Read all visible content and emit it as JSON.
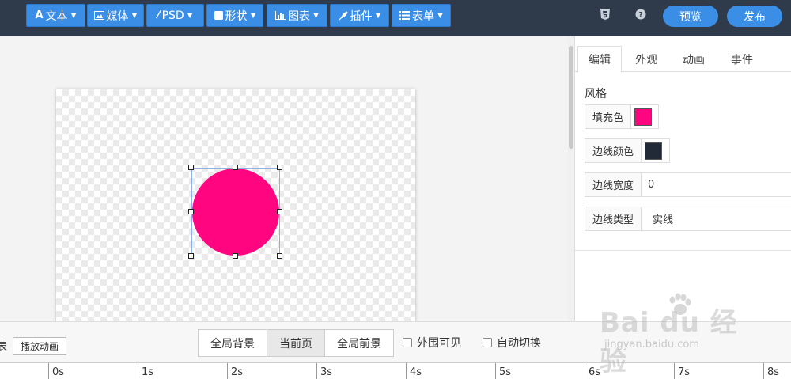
{
  "toolbar": {
    "items": [
      {
        "label": "文本",
        "icon": "text-icon"
      },
      {
        "label": "媒体",
        "icon": "image-icon"
      },
      {
        "label": "PSD",
        "icon": "magic-wand-icon"
      },
      {
        "label": "形状",
        "icon": "square-icon"
      },
      {
        "label": "图表",
        "icon": "bar-chart-icon"
      },
      {
        "label": "插件",
        "icon": "plug-icon"
      },
      {
        "label": "表单",
        "icon": "list-icon"
      }
    ],
    "preview_label": "预览",
    "publish_label": "发布",
    "accent_color": "#3b8ee6",
    "bar_color": "#2f3a4a"
  },
  "canvas": {
    "shape": "circle",
    "fill_color": "#ff0580",
    "border_color": "#222a38"
  },
  "panel": {
    "tabs": [
      "编辑",
      "外观",
      "动画",
      "事件"
    ],
    "active_tab": "编辑",
    "section_title": "风格",
    "fill_label": "填充色",
    "border_color_label": "边线颜色",
    "border_width_label": "边线宽度",
    "border_width_value": "0",
    "border_type_label": "边线类型",
    "border_type_value": "实线"
  },
  "bottom": {
    "truncated_text": "表",
    "play_label": "播放动画",
    "segments": [
      "全局背景",
      "当前页",
      "全局前景"
    ],
    "active_segment": "当前页",
    "checkbox_outside_visible": "外围可见",
    "checkbox_auto_switch": "自动切换"
  },
  "timeline": {
    "ticks": [
      "0s",
      "1s",
      "2s",
      "3s",
      "4s",
      "5s",
      "6s",
      "7s",
      "8s"
    ]
  },
  "watermark": {
    "logo_text": "Bai du 经验",
    "url": "jingyan.baidu.com"
  }
}
